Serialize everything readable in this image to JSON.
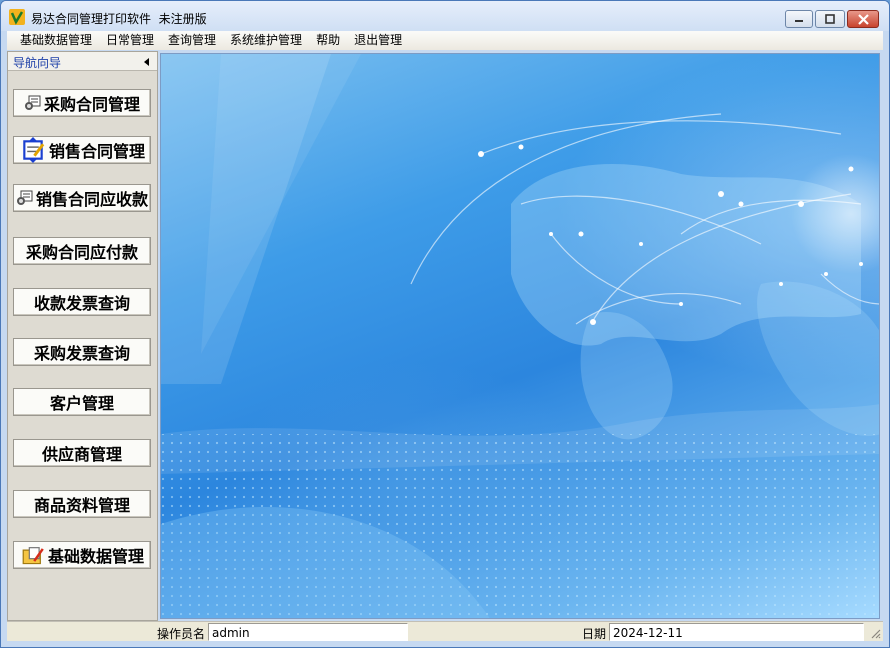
{
  "window": {
    "title": "易达合同管理打印软件  未注册版",
    "min_label": "—",
    "max_label": "▢",
    "close_label": "✕"
  },
  "menubar": {
    "items": [
      "基础数据管理",
      "日常管理",
      "查询管理",
      "系统维护管理",
      "帮助",
      "退出管理"
    ]
  },
  "nav": {
    "title": "导航向导",
    "buttons": [
      {
        "label": "采购合同管理",
        "icon": "contract-icon"
      },
      {
        "label": "销售合同管理",
        "icon": "document-edit-icon"
      },
      {
        "label": "销售合同应收款",
        "icon": "contract-icon"
      },
      {
        "label": "采购合同应付款",
        "icon": ""
      },
      {
        "label": "收款发票查询",
        "icon": ""
      },
      {
        "label": "采购发票查询",
        "icon": ""
      },
      {
        "label": "客户管理",
        "icon": ""
      },
      {
        "label": "供应商管理",
        "icon": ""
      },
      {
        "label": "商品资料管理",
        "icon": ""
      },
      {
        "label": "基础数据管理",
        "icon": "folder-edit-icon"
      }
    ]
  },
  "status": {
    "operator_label": "操作员名",
    "operator_value": "admin",
    "date_label": "日期",
    "date_value": "2024-12-11"
  }
}
